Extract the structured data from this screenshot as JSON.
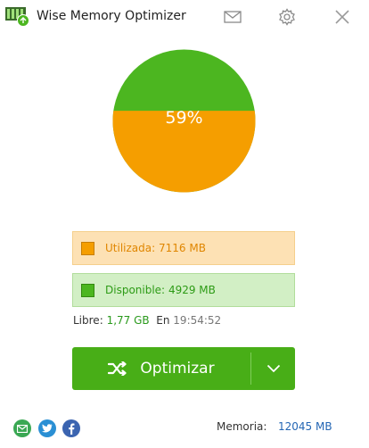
{
  "window": {
    "title": "Wise Memory Optimizer",
    "icons": {
      "logo": "app-logo-icon",
      "mail": "mail-icon",
      "settings": "gear-icon",
      "close": "close-icon"
    }
  },
  "usage": {
    "percent": 59,
    "percent_label": "59%",
    "colors": {
      "used": "#f59e00",
      "available": "#4cb620"
    }
  },
  "legend": {
    "used": {
      "label": "Utilizada:",
      "value": "7116 MB"
    },
    "available": {
      "label": "Disponible:",
      "value": "4929 MB"
    }
  },
  "status": {
    "free_label": "Libre:",
    "free_value": "1,77 GB",
    "at_label": "En",
    "time": "19:54:52"
  },
  "optimize_button": {
    "label": "Optimizar",
    "icon": "shuffle-icon",
    "dropdown_icon": "chevron-down-icon",
    "color": "#48ae17"
  },
  "footer": {
    "social_icons": [
      "mail-share-icon",
      "twitter-icon",
      "facebook-icon"
    ],
    "memory_label": "Memoria:",
    "memory_value": "12045 MB"
  }
}
